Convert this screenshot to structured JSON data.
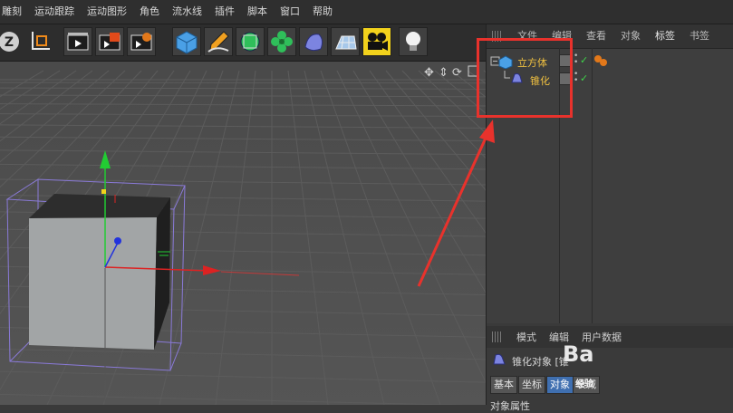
{
  "menu": [
    "雕刻",
    "运动跟踪",
    "运动图形",
    "角色",
    "流水线",
    "插件",
    "脚本",
    "窗口",
    "帮助"
  ],
  "toolbar": {
    "icons": [
      "undo-z-icon",
      "axis-icon",
      "render-view-icon",
      "render-region-icon",
      "render-settings-icon",
      "cube-icon",
      "pen-icon",
      "subdivision-icon",
      "cloner-icon",
      "deformer-icon",
      "floor-icon",
      "camera-icon",
      "light-icon"
    ]
  },
  "object_manager": {
    "tabs": [
      "文件",
      "编辑",
      "查看",
      "对象",
      "标签",
      "书签"
    ],
    "active_tab": "标签",
    "objects": [
      {
        "name": "立方体",
        "check": "✓"
      },
      {
        "name": "锥化",
        "check": "✓"
      }
    ]
  },
  "attributes": {
    "tabs": [
      "模式",
      "编辑",
      "用户数据"
    ],
    "object_label": "锥化对象 [锥",
    "subtabs": [
      "基本",
      "坐标",
      "对象",
      "衰减"
    ],
    "active_subtab": "对象",
    "section_label": "对象属性"
  },
  "watermark": {
    "text": "Ba",
    "sub": "经验"
  },
  "colors": {
    "highlight": "#e8322c",
    "object_name": "#f0c040",
    "axis_y": "#22cc33",
    "axis_x": "#dd2222",
    "axis_z": "#2233dd",
    "bbox": "#8a7ad8"
  }
}
